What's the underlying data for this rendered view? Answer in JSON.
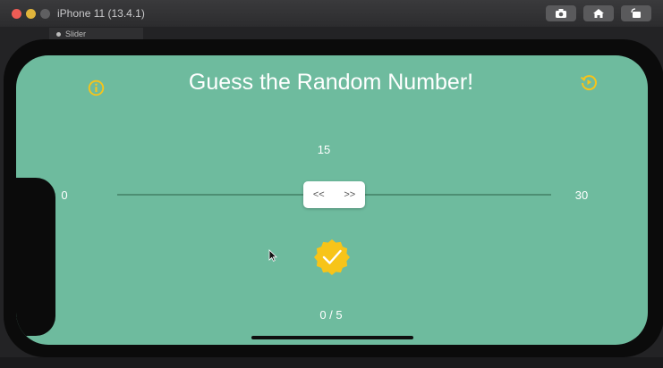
{
  "window": {
    "title": "iPhone 11 (13.4.1)",
    "behind_tab": "Slider",
    "toolbar_icons": [
      "screenshot-icon",
      "home-icon",
      "rotate-icon"
    ]
  },
  "app": {
    "title": "Guess the Random Number!",
    "slider": {
      "value": "15",
      "min_label": "0",
      "max_label": "30",
      "thumb_left": "<<",
      "thumb_right": ">>",
      "fraction": 0.5
    },
    "score": "0 / 5",
    "icons": {
      "info": "info-icon",
      "reset": "reset-icon",
      "check": "verified-check-icon"
    }
  },
  "colors": {
    "screen_background": "#6ebb9e",
    "accent": "#f7c419",
    "text": "#ffffff",
    "track": "#4d8e73"
  }
}
